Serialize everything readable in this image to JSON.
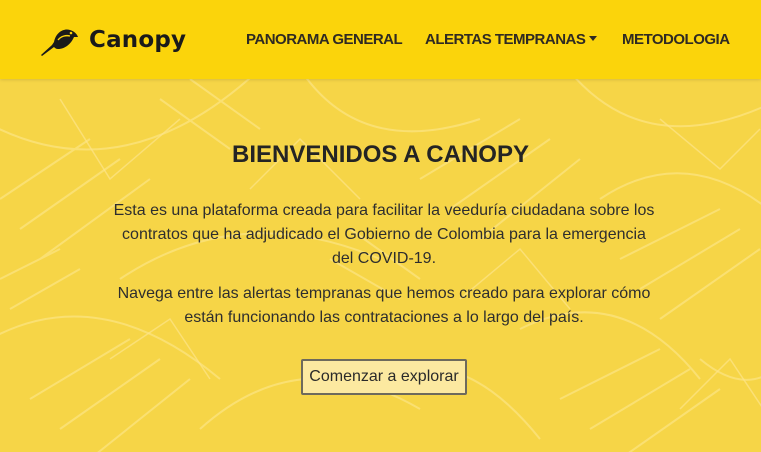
{
  "brand": {
    "name": "Canopy",
    "logo_icon": "bird-logo-icon"
  },
  "nav": {
    "items": [
      {
        "label": "PANORAMA GENERAL",
        "dropdown": false
      },
      {
        "label": "ALERTAS TEMPRANAS",
        "dropdown": true
      },
      {
        "label": "METODOLOGIA",
        "dropdown": false
      }
    ]
  },
  "hero": {
    "title": "BIENVENIDOS A CANOPY",
    "paragraph_1": "Esta es una plataforma creada para facilitar la veeduría ciudadana sobre los contratos que ha adjudicado el Gobierno de Colombia para la emergencia del COVID-19.",
    "paragraph_2": "Navega entre las alertas tempranas que hemos creado para explorar cómo están funcionando las contrataciones a lo largo del país.",
    "cta_label": "Comenzar a explorar"
  },
  "colors": {
    "navbar_bg": "#fbd40b",
    "page_bg": "#f6d547",
    "text": "#2a2a2a",
    "button_border": "#6e6a5c",
    "button_bg": "#fce9a0"
  }
}
